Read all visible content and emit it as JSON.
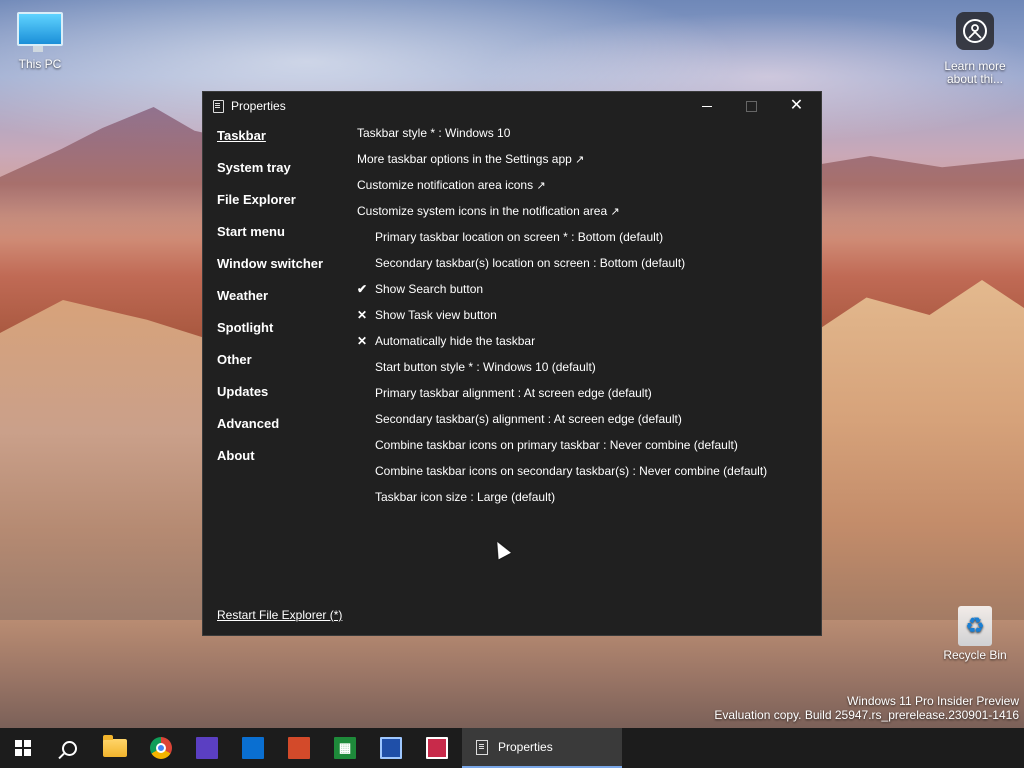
{
  "desktop": {
    "this_pc_label": "This PC",
    "learn_more_label_line1": "Learn more",
    "learn_more_label_line2": "about thi...",
    "recycle_bin_label": "Recycle Bin",
    "watermark_line1": "Windows 11 Pro Insider Preview",
    "watermark_line2": "Evaluation copy. Build 25947.rs_prerelease.230901-1416"
  },
  "window": {
    "title": "Properties",
    "minimize_label": "Minimize",
    "maximize_label": "Maximize",
    "close_label": "Close"
  },
  "sidebar": {
    "items": [
      {
        "label": "Taskbar",
        "active": true
      },
      {
        "label": "System tray"
      },
      {
        "label": "File Explorer"
      },
      {
        "label": "Start menu"
      },
      {
        "label": "Window switcher"
      },
      {
        "label": "Weather"
      },
      {
        "label": "Spotlight"
      },
      {
        "label": "Other"
      },
      {
        "label": "Updates"
      },
      {
        "label": "Advanced"
      },
      {
        "label": "About"
      }
    ],
    "restart_label": "Restart File Explorer (*)"
  },
  "settings": {
    "rows": [
      {
        "label": "Taskbar style * : Windows 10"
      },
      {
        "label": "More taskbar options in the Settings app",
        "external": "↗"
      },
      {
        "label": "Customize notification area icons",
        "external": "↗"
      },
      {
        "label": "Customize system icons in the notification area",
        "external": "↗"
      },
      {
        "label": "Primary taskbar location on screen * : Bottom (default)"
      },
      {
        "label": "Secondary taskbar(s) location on screen : Bottom (default)"
      },
      {
        "label": "Show Search button",
        "mark": "✔"
      },
      {
        "label": "Show Task view button",
        "mark": "✕"
      },
      {
        "label": "Automatically hide the taskbar",
        "mark": "✕"
      },
      {
        "label": "Start button style * : Windows 10 (default)"
      },
      {
        "label": "Primary taskbar alignment : At screen edge (default)"
      },
      {
        "label": "Secondary taskbar(s) alignment : At screen edge (default)"
      },
      {
        "label": "Combine taskbar icons on primary taskbar : Never combine (default)"
      },
      {
        "label": "Combine taskbar icons on secondary taskbar(s) : Never combine (default)"
      },
      {
        "label": "Taskbar icon size : Large (default)"
      }
    ]
  },
  "taskbar": {
    "calc_glyph": "▦",
    "active_task_label": "Properties",
    "accent_color": "#7aa7e8"
  }
}
